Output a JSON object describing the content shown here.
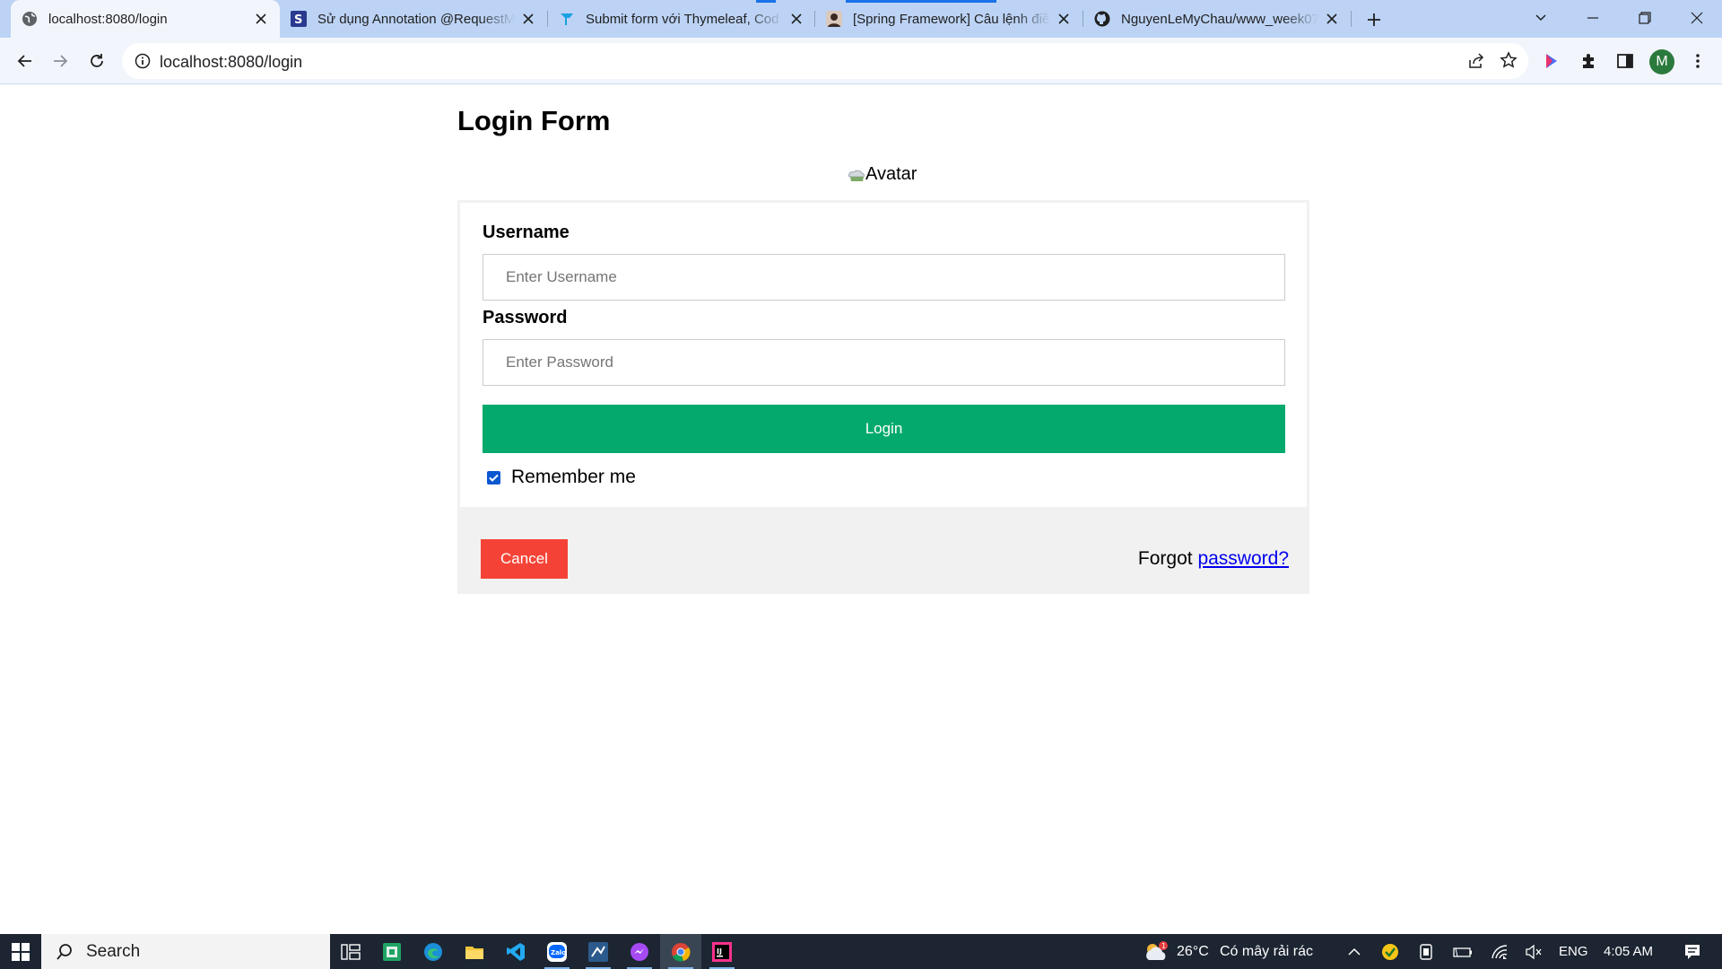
{
  "browser": {
    "tabs": [
      {
        "title": "localhost:8080/login",
        "favicon": "globe-icon",
        "active": true
      },
      {
        "title": "Sử dụng Annotation @RequestM",
        "favicon": "s-logo-icon",
        "active": false
      },
      {
        "title": "Submit form với Thymeleaf, Cod",
        "favicon": "t-logo-icon",
        "active": false
      },
      {
        "title": "[Spring Framework] Câu lệnh điề",
        "favicon": "avatar-photo-icon",
        "active": false
      },
      {
        "title": "NguyenLeMyChau/www_week07",
        "favicon": "github-icon",
        "active": false
      }
    ],
    "address": "localhost:8080/login",
    "profile_initial": "M"
  },
  "page": {
    "heading": "Login Form",
    "avatar_alt": "Avatar",
    "username_label": "Username",
    "username_placeholder": "Enter Username",
    "username_value": "",
    "password_label": "Password",
    "password_placeholder": "Enter Password",
    "password_value": "",
    "login_label": "Login",
    "remember_label": "Remember me",
    "remember_checked": true,
    "cancel_label": "Cancel",
    "forgot_prefix": "Forgot ",
    "forgot_link": "password?"
  },
  "colors": {
    "login_button": "#04aa6d",
    "cancel_button": "#f44336",
    "footer_bg": "#f1f1f1",
    "link": "#0000ee"
  },
  "taskbar": {
    "search_label": "Search",
    "weather_temp": "26°C",
    "weather_desc": "Có mây rải rác",
    "weather_badge": "1",
    "language": "ENG",
    "time": "4:05 AM",
    "apps": [
      "task-view-icon",
      "green-app-icon",
      "edge-icon",
      "file-explorer-icon",
      "vscode-icon",
      "zalo-icon",
      "ssms-icon",
      "messenger-icon",
      "chrome-icon",
      "intellij-icon"
    ]
  }
}
